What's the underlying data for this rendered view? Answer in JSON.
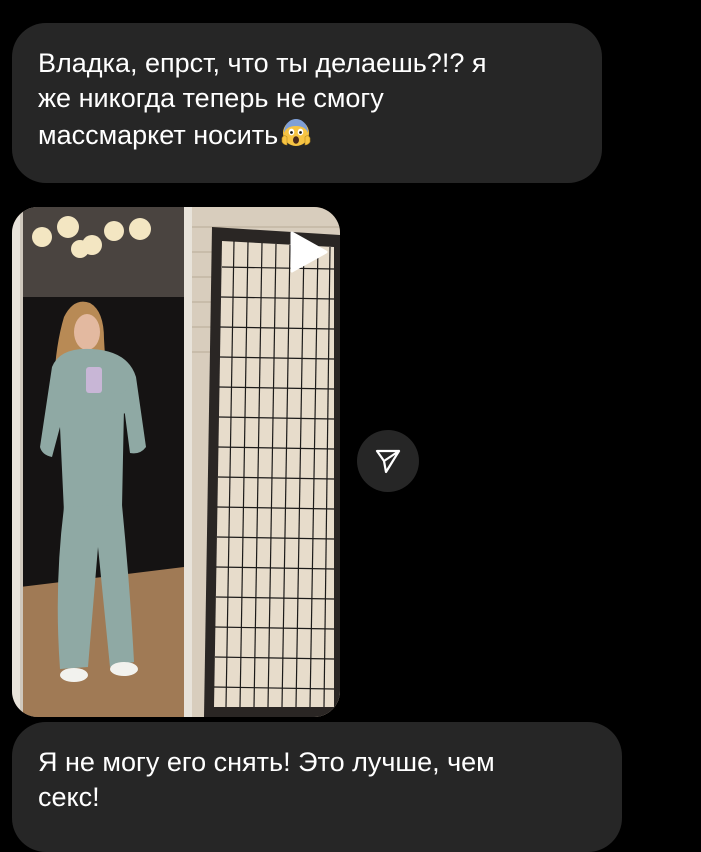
{
  "messages": [
    {
      "id": "msg-1",
      "lines": [
        "Владка, епрст, что ты делаешь?!? я",
        "же никогда теперь не смогу",
        "массмаркет носить"
      ],
      "emoji": "face-screaming-in-fear-emoji"
    },
    {
      "id": "msg-2",
      "lines": [
        "Я не могу его снять! Это лучше, чем",
        "секс!"
      ]
    }
  ],
  "story": {
    "media": "mirror-selfie-photo",
    "play_icon": "play-icon",
    "share_icon": "paper-plane-share-icon"
  },
  "colors": {
    "background": "#000000",
    "bubble": "#262626",
    "text": "#ffffff"
  }
}
